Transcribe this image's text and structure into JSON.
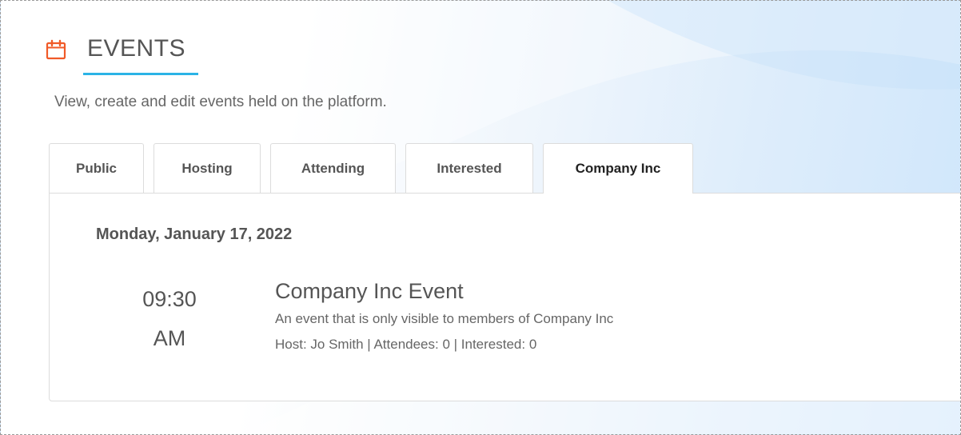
{
  "header": {
    "icon": "calendar-icon",
    "accent_color": "#f05a28",
    "underline_color": "#2bb3e6",
    "title": "EVENTS",
    "subtitle": "View, create and edit events held on the platform."
  },
  "tabs": [
    {
      "label": "Public",
      "active": false
    },
    {
      "label": "Hosting",
      "active": false
    },
    {
      "label": "Attending",
      "active": false
    },
    {
      "label": "Interested",
      "active": false
    },
    {
      "label": "Company Inc",
      "active": true
    }
  ],
  "panel": {
    "date": "Monday, January 17, 2022",
    "event": {
      "time": "09:30",
      "ampm": "AM",
      "title": "Company Inc Event",
      "description": "An event that is only visible to members of Company Inc",
      "meta": "Host: Jo Smith | Attendees: 0 | Interested: 0"
    }
  }
}
